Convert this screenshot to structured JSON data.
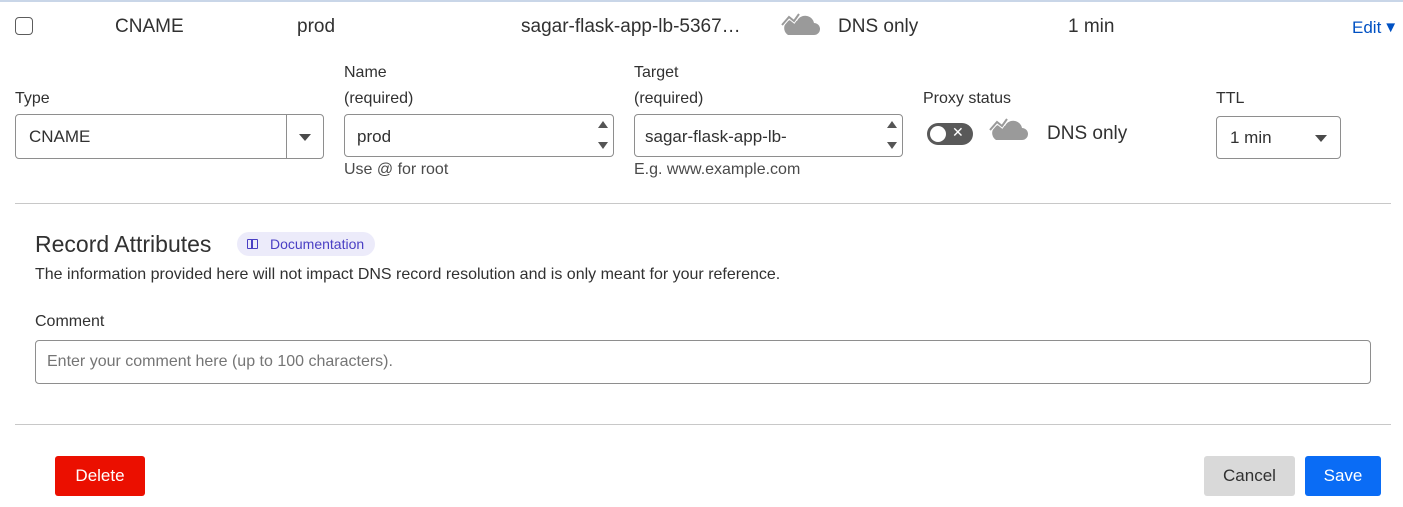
{
  "record_row": {
    "type": "CNAME",
    "name": "prod",
    "content": "sagar-flask-app-lb-5367…",
    "proxy_icon": "cloud-off-icon",
    "proxy_status": "DNS only",
    "ttl": "1 min",
    "edit_label": "Edit"
  },
  "form": {
    "type": {
      "label": "Type",
      "value": "CNAME"
    },
    "name": {
      "label_line1": "Name",
      "label_line2": "(required)",
      "value": "prod",
      "hint": "Use @ for root"
    },
    "target": {
      "label_line1": "Target",
      "label_line2": "(required)",
      "value": "sagar-flask-app-lb-",
      "hint": "E.g. www.example.com"
    },
    "proxy": {
      "label": "Proxy status",
      "enabled": false,
      "status_text": "DNS only"
    },
    "ttl": {
      "label": "TTL",
      "value": "1 min"
    }
  },
  "record_attributes": {
    "title": "Record Attributes",
    "doc_label": "Documentation",
    "description": "The information provided here will not impact DNS record resolution and is only meant for your reference.",
    "comment_label": "Comment",
    "comment_placeholder": "Enter your comment here (up to 100 characters)."
  },
  "actions": {
    "delete_label": "Delete",
    "cancel_label": "Cancel",
    "save_label": "Save"
  },
  "colors": {
    "link": "#0051c3",
    "delete": "#eb0f00",
    "save": "#0a6cf5",
    "cancel": "#d9d9d9",
    "doc_pill_bg": "#ecebfa",
    "doc_pill_text": "#4a3fc4"
  }
}
